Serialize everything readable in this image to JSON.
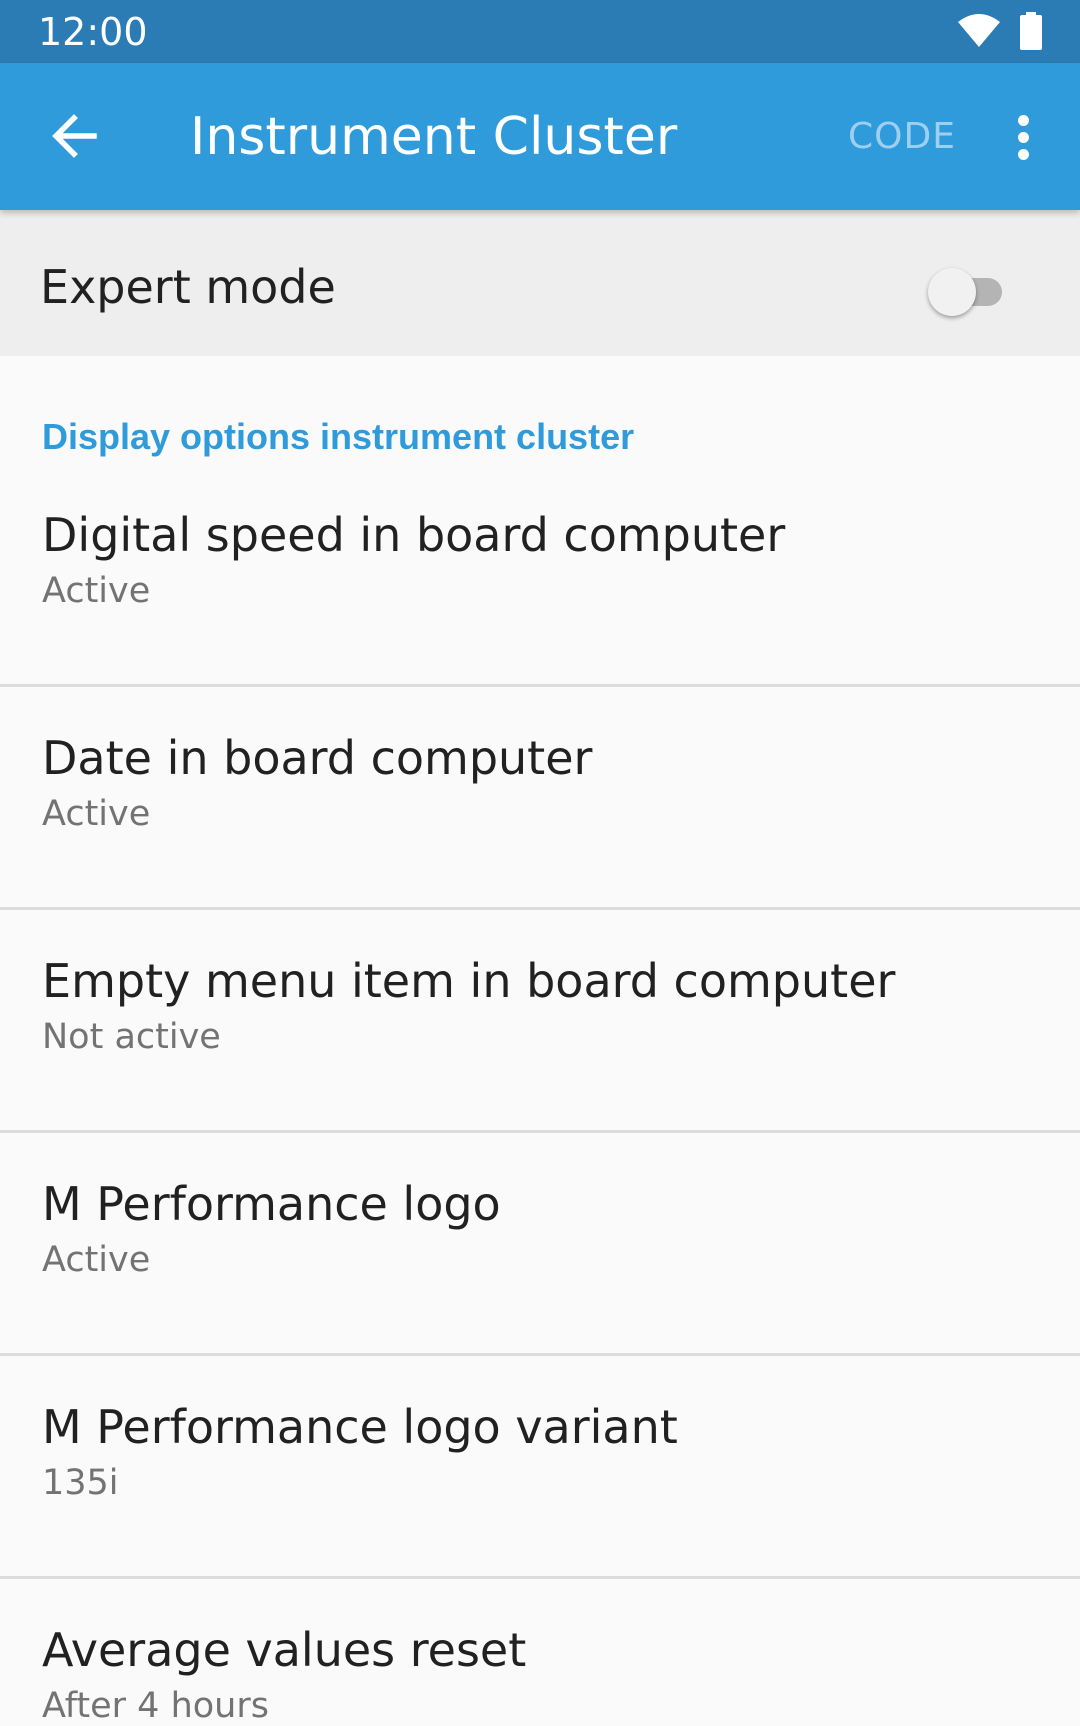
{
  "status_bar": {
    "time": "12:00"
  },
  "app_bar": {
    "title": "Instrument Cluster",
    "code_label": "CODE"
  },
  "expert_mode": {
    "label": "Expert mode",
    "enabled": false
  },
  "section": {
    "header": "Display options instrument cluster"
  },
  "preferences": [
    {
      "title": "Digital speed in board computer",
      "summary": "Active"
    },
    {
      "title": "Date in board computer",
      "summary": "Active"
    },
    {
      "title": "Empty menu item in board computer",
      "summary": "Not active"
    },
    {
      "title": "M Performance logo",
      "summary": "Active"
    },
    {
      "title": "M Performance logo variant",
      "summary": "135i"
    },
    {
      "title": "Average values reset",
      "summary": "After 4 hours"
    }
  ],
  "colors": {
    "status_bar": "#2b7cb5",
    "app_bar": "#2f9bdb",
    "accent": "#2f9bdb",
    "expert_row_bg": "#eeeeee",
    "background": "#fafafa"
  },
  "icons": {
    "back": "arrow-back-icon",
    "more": "more-vert-icon",
    "wifi": "wifi-icon",
    "battery": "battery-icon"
  }
}
